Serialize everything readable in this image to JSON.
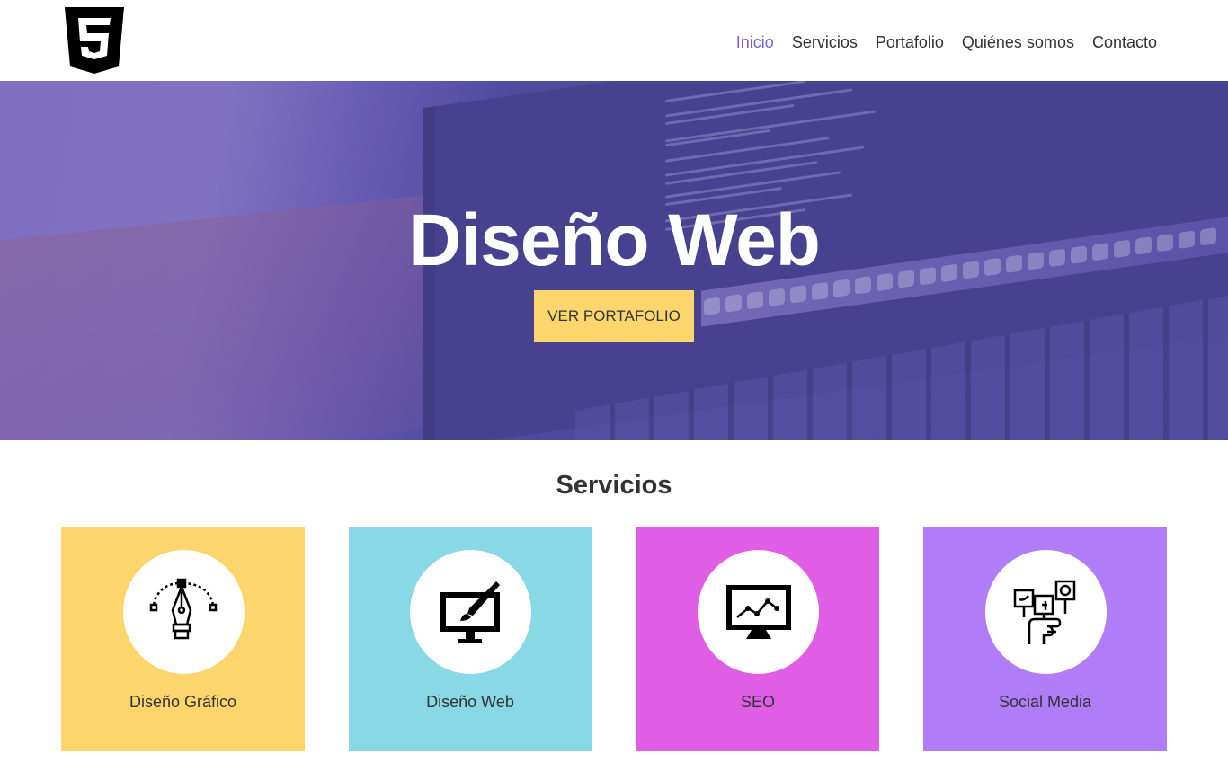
{
  "header": {
    "logo": "html5-logo",
    "nav": [
      {
        "label": "Inicio",
        "active": true
      },
      {
        "label": "Servicios",
        "active": false
      },
      {
        "label": "Portafolio",
        "active": false
      },
      {
        "label": "Quiénes somos",
        "active": false
      },
      {
        "label": "Contacto",
        "active": false
      }
    ]
  },
  "hero": {
    "title": "Diseño Web",
    "button_label": "VER PORTAFOLIO"
  },
  "services": {
    "title": "Servicios",
    "items": [
      {
        "label": "Diseño Gráfico",
        "icon": "pen-tool-icon",
        "color": "#fcd66c"
      },
      {
        "label": "Diseño Web",
        "icon": "monitor-brush-icon",
        "color": "#89d8e6"
      },
      {
        "label": "SEO",
        "icon": "monitor-chart-icon",
        "color": "#e05de6"
      },
      {
        "label": "Social Media",
        "icon": "social-hand-icon",
        "color": "#b07cf7"
      }
    ]
  },
  "colors": {
    "accent": "#7a5fd8",
    "button": "#fcd66c",
    "hero_overlay": "#4f4b9a"
  }
}
